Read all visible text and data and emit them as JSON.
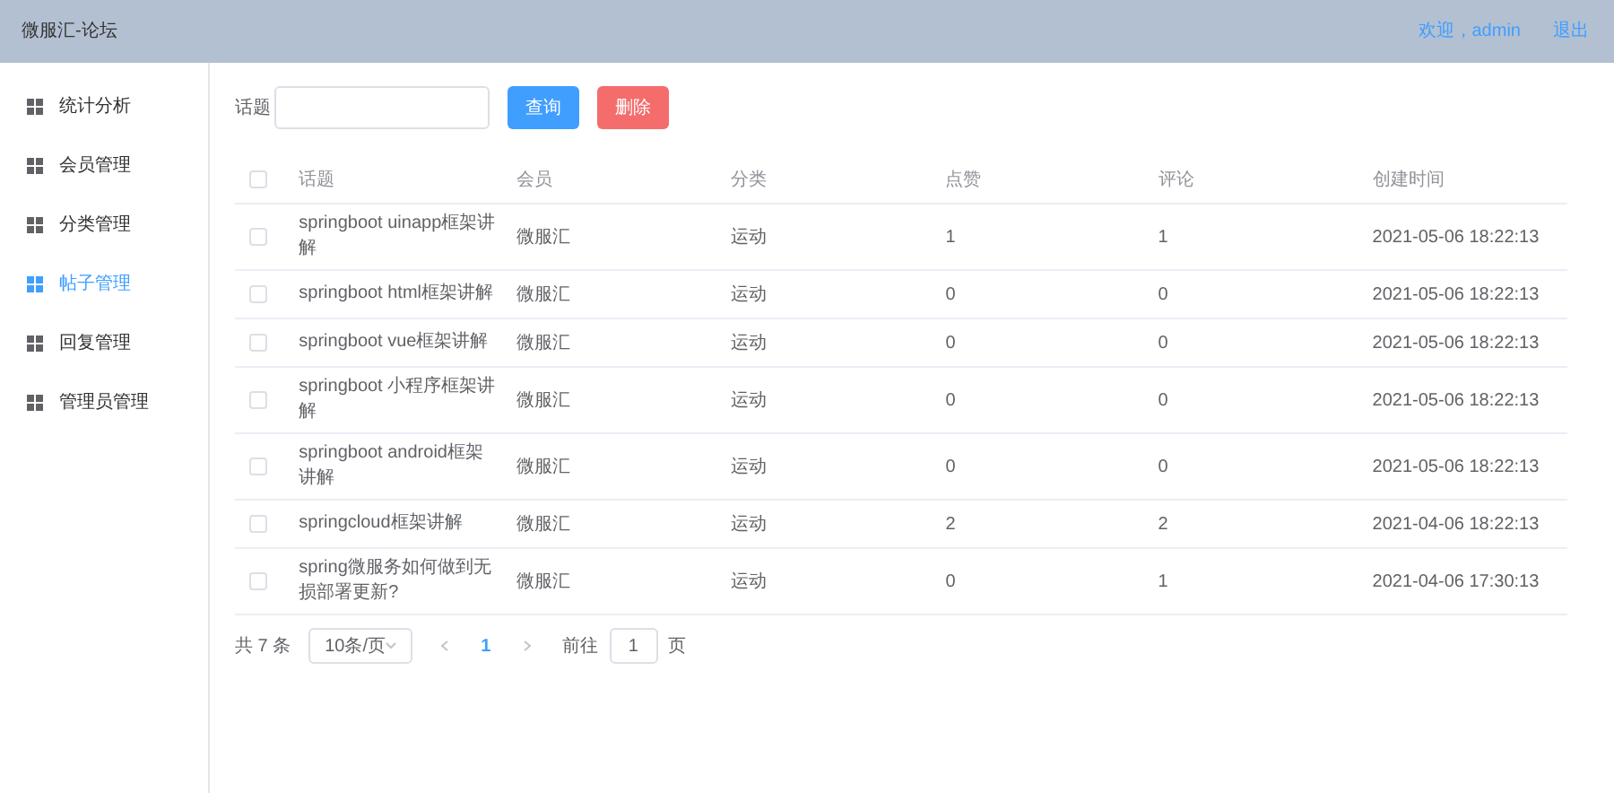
{
  "header": {
    "title": "微服汇-论坛",
    "welcome": "欢迎，admin",
    "logout": "退出"
  },
  "sidebar": {
    "items": [
      {
        "label": "统计分析",
        "selected": false
      },
      {
        "label": "会员管理",
        "selected": false
      },
      {
        "label": "分类管理",
        "selected": false
      },
      {
        "label": "帖子管理",
        "selected": true
      },
      {
        "label": "回复管理",
        "selected": false
      },
      {
        "label": "管理员管理",
        "selected": false
      }
    ]
  },
  "search": {
    "label": "话题",
    "query_button": "查询",
    "delete_button": "删除"
  },
  "table": {
    "columns": [
      "话题",
      "会员",
      "分类",
      "点赞",
      "评论",
      "创建时间"
    ],
    "header_checked": false,
    "rows": [
      {
        "checked": false,
        "cells": [
          "springboot uinapp框架讲解",
          "微服汇",
          "运动",
          "1",
          "1",
          "2021-05-06 18:22:13"
        ]
      },
      {
        "checked": false,
        "cells": [
          "springboot html框架讲解",
          "微服汇",
          "运动",
          "0",
          "0",
          "2021-05-06 18:22:13"
        ]
      },
      {
        "checked": false,
        "cells": [
          "springboot vue框架讲解",
          "微服汇",
          "运动",
          "0",
          "0",
          "2021-05-06 18:22:13"
        ]
      },
      {
        "checked": false,
        "cells": [
          "springboot 小程序框架讲解",
          "微服汇",
          "运动",
          "0",
          "0",
          "2021-05-06 18:22:13"
        ]
      },
      {
        "checked": false,
        "cells": [
          "springboot android框架讲解",
          "微服汇",
          "运动",
          "0",
          "0",
          "2021-05-06 18:22:13"
        ]
      },
      {
        "checked": false,
        "cells": [
          "springcloud框架讲解",
          "微服汇",
          "运动",
          "2",
          "2",
          "2021-04-06 18:22:13"
        ]
      },
      {
        "checked": false,
        "cells": [
          "spring微服务如何做到无损部署更新?",
          "微服汇",
          "运动",
          "0",
          "1",
          "2021-04-06 17:30:13"
        ]
      }
    ]
  },
  "pagination": {
    "total": "共 7 条",
    "page_size": "10条/页",
    "pages": [
      {
        "label": "1",
        "selected": true
      }
    ],
    "goto_label": "前往",
    "goto_value": "1",
    "goto_suffix": "页"
  }
}
